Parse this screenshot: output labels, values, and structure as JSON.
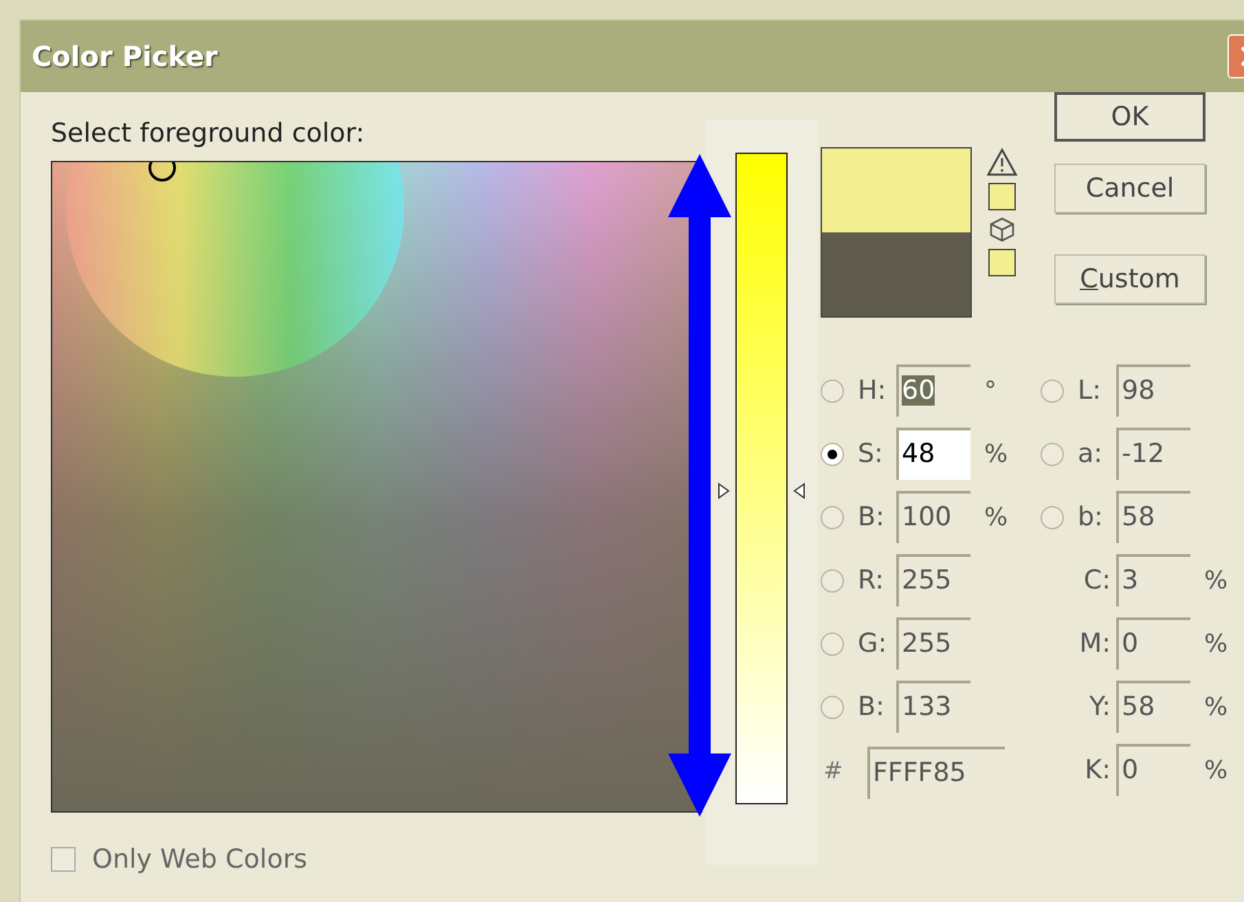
{
  "window": {
    "title": "Color Picker"
  },
  "prompt": "Select foreground color:",
  "slider": {
    "level": 0.48
  },
  "swatches": [
    {
      "color": "#f3ef91"
    },
    {
      "color": "#5f5b4d"
    }
  ],
  "small_swatches": [
    {
      "color": "#f3ef91"
    },
    {
      "color": "#f3ef91"
    }
  ],
  "buttons": [
    {
      "label": "OK",
      "default": true
    },
    {
      "label": "Cancel",
      "default": false
    },
    {
      "label": "Custom",
      "default": false
    }
  ],
  "fields_left": [
    {
      "kind": "radio",
      "label": "H:",
      "value": "60",
      "unit": "°",
      "selected": false,
      "focused": false,
      "text_highlighted": true
    },
    {
      "kind": "radio",
      "label": "S:",
      "value": "48",
      "unit": "%",
      "selected": true,
      "focused": true,
      "text_highlighted": false
    },
    {
      "kind": "radio",
      "label": "B:",
      "value": "100",
      "unit": "%",
      "selected": false,
      "focused": false,
      "text_highlighted": false
    },
    {
      "kind": "radio",
      "label": "R:",
      "value": "255",
      "selected": false,
      "focused": false,
      "text_highlighted": false
    },
    {
      "kind": "radio",
      "label": "G:",
      "value": "255",
      "selected": false,
      "focused": false,
      "text_highlighted": false
    },
    {
      "kind": "radio",
      "label": "B:",
      "value": "133",
      "selected": false,
      "focused": false,
      "text_highlighted": false
    },
    {
      "kind": "hex",
      "label": "#",
      "value": "FFFF85"
    }
  ],
  "fields_right": [
    {
      "kind": "radio",
      "label": "L:",
      "value": "98",
      "selected": false
    },
    {
      "kind": "radio",
      "label": "a:",
      "value": "-12",
      "selected": false
    },
    {
      "kind": "radio",
      "label": "b:",
      "value": "58",
      "selected": false
    },
    {
      "kind": "plain",
      "label": "C:",
      "value": "3",
      "unit": "%"
    },
    {
      "kind": "plain",
      "label": "M:",
      "value": "0",
      "unit": "%"
    },
    {
      "kind": "plain",
      "label": "Y:",
      "value": "58",
      "unit": "%"
    },
    {
      "kind": "plain",
      "label": "K:",
      "value": "0",
      "unit": "%"
    }
  ],
  "web_colors": {
    "label": "Only Web Colors",
    "checked": false
  }
}
